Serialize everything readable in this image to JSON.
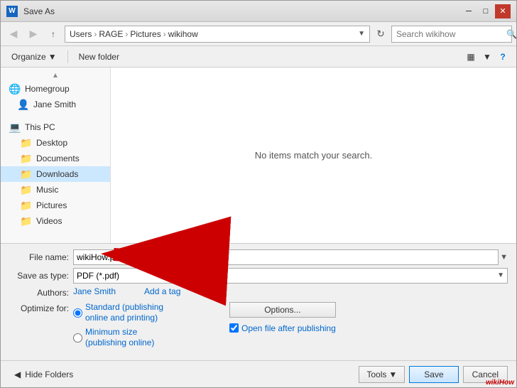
{
  "window": {
    "title": "Save As",
    "icon": "W"
  },
  "addressbar": {
    "back_disabled": true,
    "forward_disabled": true,
    "path": [
      {
        "label": "Users"
      },
      {
        "label": "RAGE"
      },
      {
        "label": "Pictures"
      },
      {
        "label": "wikihow"
      }
    ],
    "search_placeholder": "Search wikihow"
  },
  "toolbar": {
    "organize_label": "Organize",
    "new_folder_label": "New folder"
  },
  "sidebar": {
    "scroll_up": "▲",
    "sections": [
      {
        "items": [
          {
            "label": "Homegroup",
            "icon": "homegroup"
          },
          {
            "label": "Jane Smith",
            "icon": "user"
          }
        ]
      },
      {
        "items": [
          {
            "label": "This PC",
            "icon": "thispc"
          },
          {
            "label": "Desktop",
            "icon": "folder",
            "indent": true
          },
          {
            "label": "Documents",
            "icon": "folder",
            "indent": true
          },
          {
            "label": "Downloads",
            "icon": "folder",
            "indent": true,
            "selected": true
          },
          {
            "label": "Music",
            "icon": "folder",
            "indent": true
          },
          {
            "label": "Pictures",
            "icon": "folder",
            "indent": true
          },
          {
            "label": "Videos",
            "icon": "folder",
            "indent": true
          }
        ]
      }
    ]
  },
  "content": {
    "empty_message": "No items match your search."
  },
  "form": {
    "filename_label": "File name:",
    "filename_value": "wikiHow.pdf",
    "savetype_label": "Save as type:",
    "savetype_value": "PDF (*.pdf)",
    "authors_label": "Authors:",
    "authors_value": "Jane Smith",
    "add_tag_label": "Add a tag",
    "optimize_label": "Optimize for:",
    "optimize_options": [
      {
        "label": "Standard (publishing",
        "sub": "online and printing)",
        "value": "standard",
        "checked": true
      },
      {
        "label": "Minimum size",
        "sub": "(publishing online)",
        "value": "minimum",
        "checked": false
      }
    ],
    "options_btn_label": "Options...",
    "checkbox_label": "Open file after publishing",
    "checkbox_checked": true
  },
  "footer": {
    "hide_folders_label": "Hide Folders",
    "tools_label": "Tools",
    "save_label": "Save",
    "cancel_label": "Cancel"
  },
  "icons": {
    "back": "◀",
    "forward": "▶",
    "up": "↑",
    "refresh": "↻",
    "search": "🔍",
    "organize_arrow": "▼",
    "view_icon": "▦",
    "view_arrow": "▼",
    "help": "?",
    "hide_arrow": "◀",
    "tools_arrow": "▼",
    "chevron_right": "›",
    "dropdown": "▼"
  },
  "watermark": "wikiHow"
}
